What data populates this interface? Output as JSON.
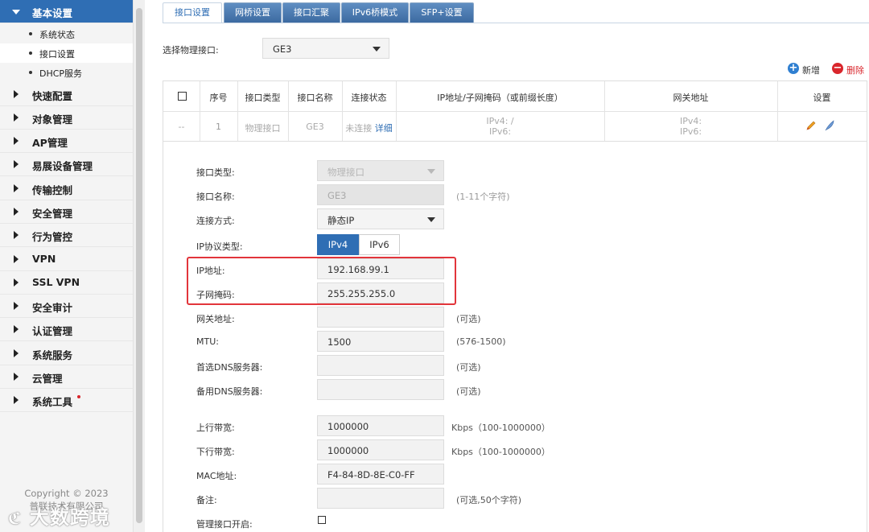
{
  "sidebar": {
    "active_section": "基本设置",
    "sub_items": [
      "系统状态",
      "接口设置",
      "DHCP服务"
    ],
    "items": [
      "快速配置",
      "对象管理",
      "AP管理",
      "易展设备管理",
      "传输控制",
      "安全管理",
      "行为管控",
      "VPN",
      "SSL VPN",
      "安全审计",
      "认证管理",
      "系统服务",
      "云管理",
      "系统工具"
    ],
    "copyright_line1": "Copyright © 2023",
    "copyright_line2": "普联技术有限公司"
  },
  "tabs": [
    "接口设置",
    "网桥设置",
    "接口汇聚",
    "IPv6桥模式",
    "SFP+设置"
  ],
  "interface_select": {
    "label": "选择物理接口:",
    "value": "GE3"
  },
  "actions": {
    "add": "新增",
    "delete": "删除"
  },
  "table": {
    "headers": [
      "序号",
      "接口类型",
      "接口名称",
      "连接状态",
      "IP地址/子网掩码（或前缀长度）",
      "网关地址",
      "设置"
    ],
    "row": {
      "checkbox": "--",
      "index": "1",
      "type": "物理接口",
      "name": "GE3",
      "status": "未连接",
      "detail_link": "详细",
      "ip_v4": "IPv4:  /",
      "ip_v6": "IPv6:",
      "gw_v4": "IPv4:",
      "gw_v6": "IPv6:"
    }
  },
  "form": {
    "interface_type": {
      "label": "接口类型:",
      "value": "物理接口"
    },
    "interface_name": {
      "label": "接口名称:",
      "value": "GE3",
      "hint": "(1-11个字符)"
    },
    "connection_type": {
      "label": "连接方式:",
      "value": "静态IP"
    },
    "ip_protocol": {
      "label": "IP协议类型:",
      "options": [
        "IPv4",
        "IPv6"
      ],
      "selected": "IPv4"
    },
    "ip_address": {
      "label": "IP地址:",
      "value": "192.168.99.1"
    },
    "subnet_mask": {
      "label": "子网掩码:",
      "value": "255.255.255.0"
    },
    "gateway": {
      "label": "网关地址:",
      "value": "",
      "hint": "(可选)"
    },
    "mtu": {
      "label": "MTU:",
      "value": "1500",
      "hint": "(576-1500)"
    },
    "primary_dns": {
      "label": "首选DNS服务器:",
      "value": "",
      "hint": "(可选)"
    },
    "secondary_dns": {
      "label": "备用DNS服务器:",
      "value": "",
      "hint": "(可选)"
    },
    "upstream": {
      "label": "上行带宽:",
      "value": "1000000",
      "hint": "Kbps（100-1000000）"
    },
    "downstream": {
      "label": "下行带宽:",
      "value": "1000000",
      "hint": "Kbps（100-1000000）"
    },
    "mac": {
      "label": "MAC地址:",
      "value": "F4-84-8D-8E-C0-FF"
    },
    "remark": {
      "label": "备注:",
      "value": "",
      "hint": "(可选,50个字符)"
    },
    "mgmt_interface": {
      "label": "管理接口开启:",
      "checked": false
    }
  },
  "watermark": "大数跨境",
  "colors": {
    "accent": "#2f6eb4",
    "highlight": "#e2353b",
    "add": "#2f7fd1",
    "delete": "#d9262c"
  }
}
